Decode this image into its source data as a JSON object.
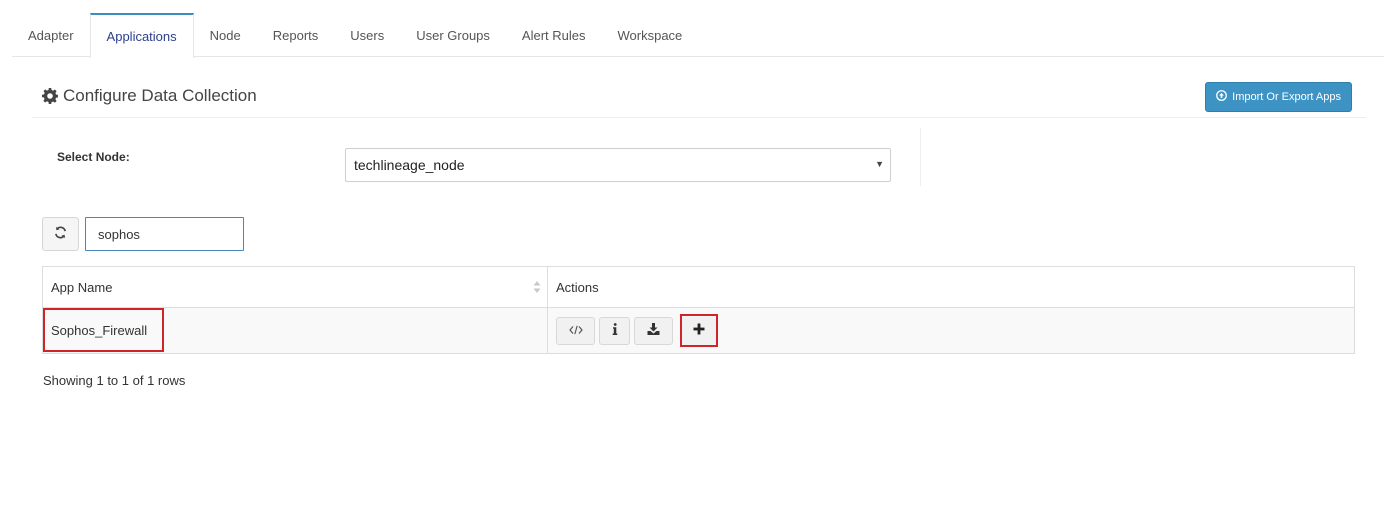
{
  "tabs": [
    {
      "label": "Adapter",
      "active": false
    },
    {
      "label": "Applications",
      "active": true
    },
    {
      "label": "Node",
      "active": false
    },
    {
      "label": "Reports",
      "active": false
    },
    {
      "label": "Users",
      "active": false
    },
    {
      "label": "User Groups",
      "active": false
    },
    {
      "label": "Alert Rules",
      "active": false
    },
    {
      "label": "Workspace",
      "active": false
    }
  ],
  "header": {
    "title": "Configure Data Collection",
    "title_icon": "gear-icon",
    "import_button": "Import Or Export Apps",
    "import_icon": "circle-arrow-icon"
  },
  "node": {
    "label": "Select Node:",
    "selected": "techlineage_node"
  },
  "search": {
    "value": "sophos",
    "refresh_icon": "refresh-icon"
  },
  "table": {
    "columns": [
      "App Name",
      "Actions"
    ],
    "rows": [
      {
        "app_name": "Sophos_Firewall",
        "actions": [
          "code-icon",
          "info-icon",
          "download-icon",
          "plus-icon"
        ]
      }
    ]
  },
  "pagination": {
    "text": "Showing 1 to 1 of 1 rows"
  },
  "colors": {
    "accent": "#3c93c4",
    "active_tab_text": "#2b3f8e",
    "highlight": "#d0242c"
  }
}
